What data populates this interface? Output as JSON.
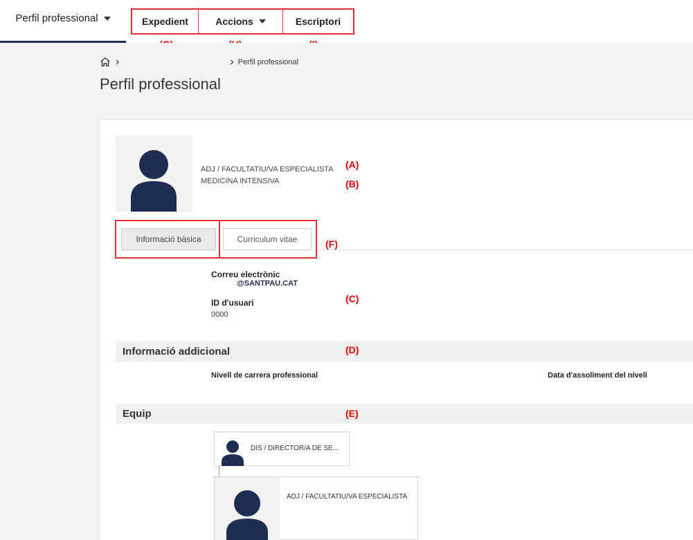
{
  "topnav": {
    "profile_tab": "Perfil professional",
    "items": [
      "Expedient",
      "Accions",
      "Escriptori"
    ]
  },
  "annotations": {
    "a": "(A)",
    "b": "(B)",
    "c": "(C)",
    "d": "(D)",
    "e": "(E)",
    "f": "(F)",
    "g": "(G)",
    "h": "(H)",
    "i": "(I)"
  },
  "breadcrumb": {
    "current": "Perfil professional"
  },
  "page_title": "Perfil professional",
  "profile": {
    "role": "ADJ / FACULTATIU/VA ESPECIALISTA",
    "specialty": "MEDICINA INTENSIVA"
  },
  "tabs": [
    "Informació bàsica",
    "Curriculum vitae"
  ],
  "basic_info": {
    "email_label": "Correu electrònic",
    "email_value": "@SANTPAU.CAT",
    "user_id_label": "ID d'usuari",
    "user_id_value": "0000"
  },
  "additional_info": {
    "title": "Informació addicional",
    "col1": "Nivell de carrera professional",
    "col2": "Data d'assoliment del nivell"
  },
  "team": {
    "title": "Equip",
    "manager": "DIS / DIRECTOR/A DE SE...",
    "member": "ADJ / FACULTATIU/VA ESPECIALISTA"
  },
  "colors": {
    "accent": "#1f2d52",
    "annotation": "#e00000",
    "avatar": "#1f2d52"
  }
}
